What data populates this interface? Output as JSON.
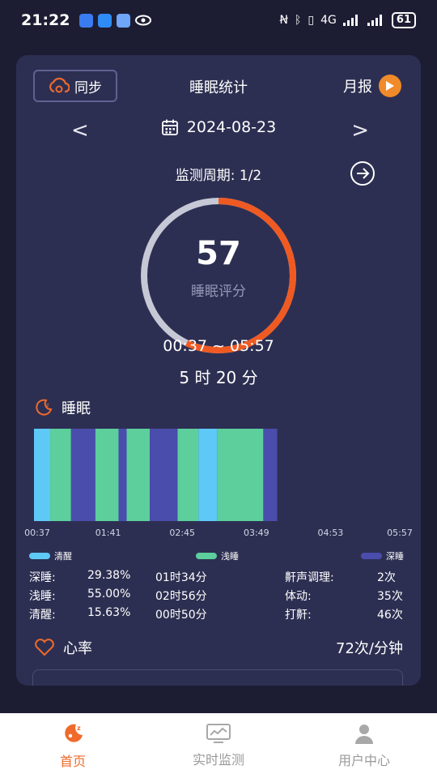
{
  "status_bar": {
    "time": "21:22",
    "battery": "61",
    "network": "4G"
  },
  "header": {
    "sync_label": "同步",
    "title": "睡眠统计",
    "monthly_label": "月报"
  },
  "date_nav": {
    "prev": "<",
    "date": "2024-08-23",
    "next": ">"
  },
  "period": {
    "label": "监测周期: 1/2"
  },
  "score": {
    "value": "57",
    "label": "睡眠评分",
    "fraction": 0.57
  },
  "time_range": "00:37 ~ 05:57",
  "duration": "5 时 20 分",
  "sleep_section": {
    "title": "睡眠",
    "axis_ticks": [
      "00:37",
      "01:41",
      "02:45",
      "03:49",
      "04:53",
      "05:57"
    ],
    "legend": [
      {
        "label": "清醒",
        "color": "#5ec8f7"
      },
      {
        "label": "浅睡",
        "color": "#5ccf9c"
      },
      {
        "label": "深睡",
        "color": "#4a4dab"
      }
    ],
    "segments": [
      {
        "stage": "清醒",
        "start": "00:37",
        "end": "00:51"
      },
      {
        "stage": "浅睡",
        "start": "00:51",
        "end": "01:09"
      },
      {
        "stage": "深睡",
        "start": "01:09",
        "end": "01:30"
      },
      {
        "stage": "浅睡",
        "start": "01:30",
        "end": "01:50"
      },
      {
        "stage": "深睡",
        "start": "01:50",
        "end": "01:57"
      },
      {
        "stage": "浅睡",
        "start": "01:57",
        "end": "02:17"
      },
      {
        "stage": "深睡",
        "start": "02:17",
        "end": "02:41"
      },
      {
        "stage": "浅睡",
        "start": "02:41",
        "end": "02:59"
      },
      {
        "stage": "清醒",
        "start": "02:59",
        "end": "03:15"
      },
      {
        "stage": "浅睡",
        "start": "03:15",
        "end": "03:55"
      },
      {
        "stage": "深睡",
        "start": "03:55",
        "end": "04:07"
      }
    ]
  },
  "stats": {
    "left": [
      {
        "label": "深睡:",
        "percent": "29.38%",
        "time": "01时34分"
      },
      {
        "label": "浅睡:",
        "percent": "55.00%",
        "time": "02时56分"
      },
      {
        "label": "清醒:",
        "percent": "15.63%",
        "time": "00时50分"
      }
    ],
    "right": [
      {
        "label": "鼾声调理:",
        "value": "2次"
      },
      {
        "label": "体动:",
        "value": "35次"
      },
      {
        "label": "打鼾:",
        "value": "46次"
      }
    ]
  },
  "heart_rate": {
    "title": "心率",
    "value": "72次/分钟"
  },
  "tabs": [
    {
      "label": "首页",
      "active": true,
      "icon": "home-moon-icon"
    },
    {
      "label": "实时监测",
      "active": false,
      "icon": "monitor-icon"
    },
    {
      "label": "用户中心",
      "active": false,
      "icon": "user-icon"
    }
  ],
  "colors": {
    "accent": "#ef6a2c",
    "card": "#2d2f52",
    "gauge_track": "#c7c8d6"
  }
}
